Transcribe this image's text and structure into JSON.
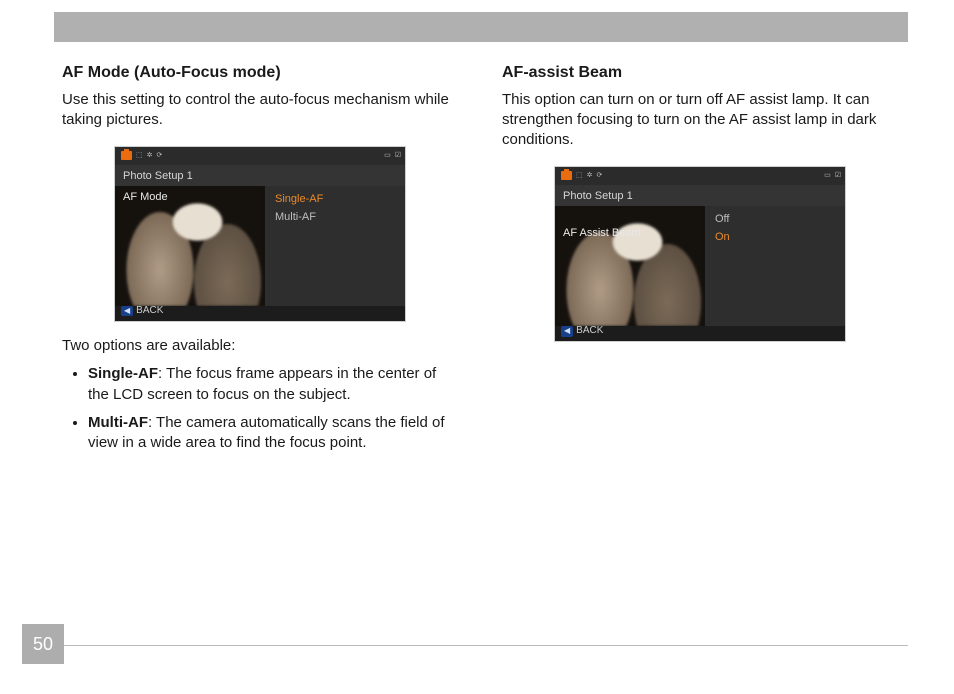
{
  "page_number": "50",
  "left": {
    "title": "AF Mode (Auto-Focus mode)",
    "desc": "Use this setting to control the auto-focus mechanism while taking pictures.",
    "lcd": {
      "menu_title": "Photo Setup 1",
      "setting_label": "AF Mode",
      "options": [
        {
          "label": "Single-AF",
          "selected": true
        },
        {
          "label": "Multi-AF",
          "selected": false
        }
      ],
      "back_chip": "◀",
      "back_label": "BACK"
    },
    "sub_intro": "Two options are available:",
    "bullets": [
      {
        "name": "Single-AF",
        "text": ": The focus frame appears in the center of the LCD screen to focus on the subject."
      },
      {
        "name": "Multi-AF",
        "text": ": The camera automatically scans the field of view in a wide area to find the focus point."
      }
    ]
  },
  "right": {
    "title": "AF-assist Beam",
    "desc": "This option can turn on or turn off AF assist lamp. It can strengthen focusing to turn on the AF assist lamp in dark conditions.",
    "lcd": {
      "menu_title": "Photo Setup 1",
      "setting_label": "AF Assist Beam",
      "options": [
        {
          "label": "Off",
          "selected": false
        },
        {
          "label": "On",
          "selected": true
        }
      ],
      "back_chip": "◀",
      "back_label": "BACK"
    }
  }
}
